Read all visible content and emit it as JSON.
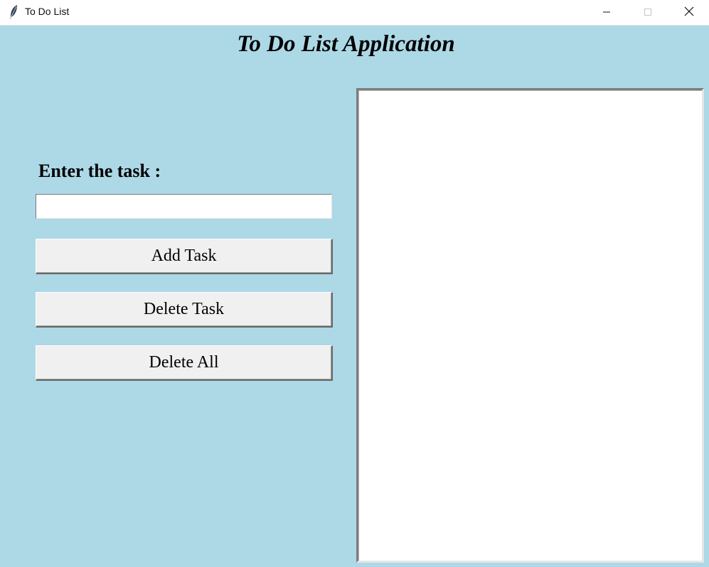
{
  "window": {
    "title": "To Do List",
    "icon": "feather-icon",
    "controls": [
      "minimize-icon",
      "maximize-icon",
      "close-icon"
    ]
  },
  "app": {
    "heading": "To Do List Application",
    "task_label": "Enter the task :",
    "task_input_value": "",
    "buttons": {
      "add": "Add Task",
      "delete": "Delete Task",
      "delete_all": "Delete All"
    },
    "tasks": []
  },
  "colors": {
    "background": "#add8e6",
    "button_face": "#f0f0f0",
    "list_background": "#ffffff"
  }
}
